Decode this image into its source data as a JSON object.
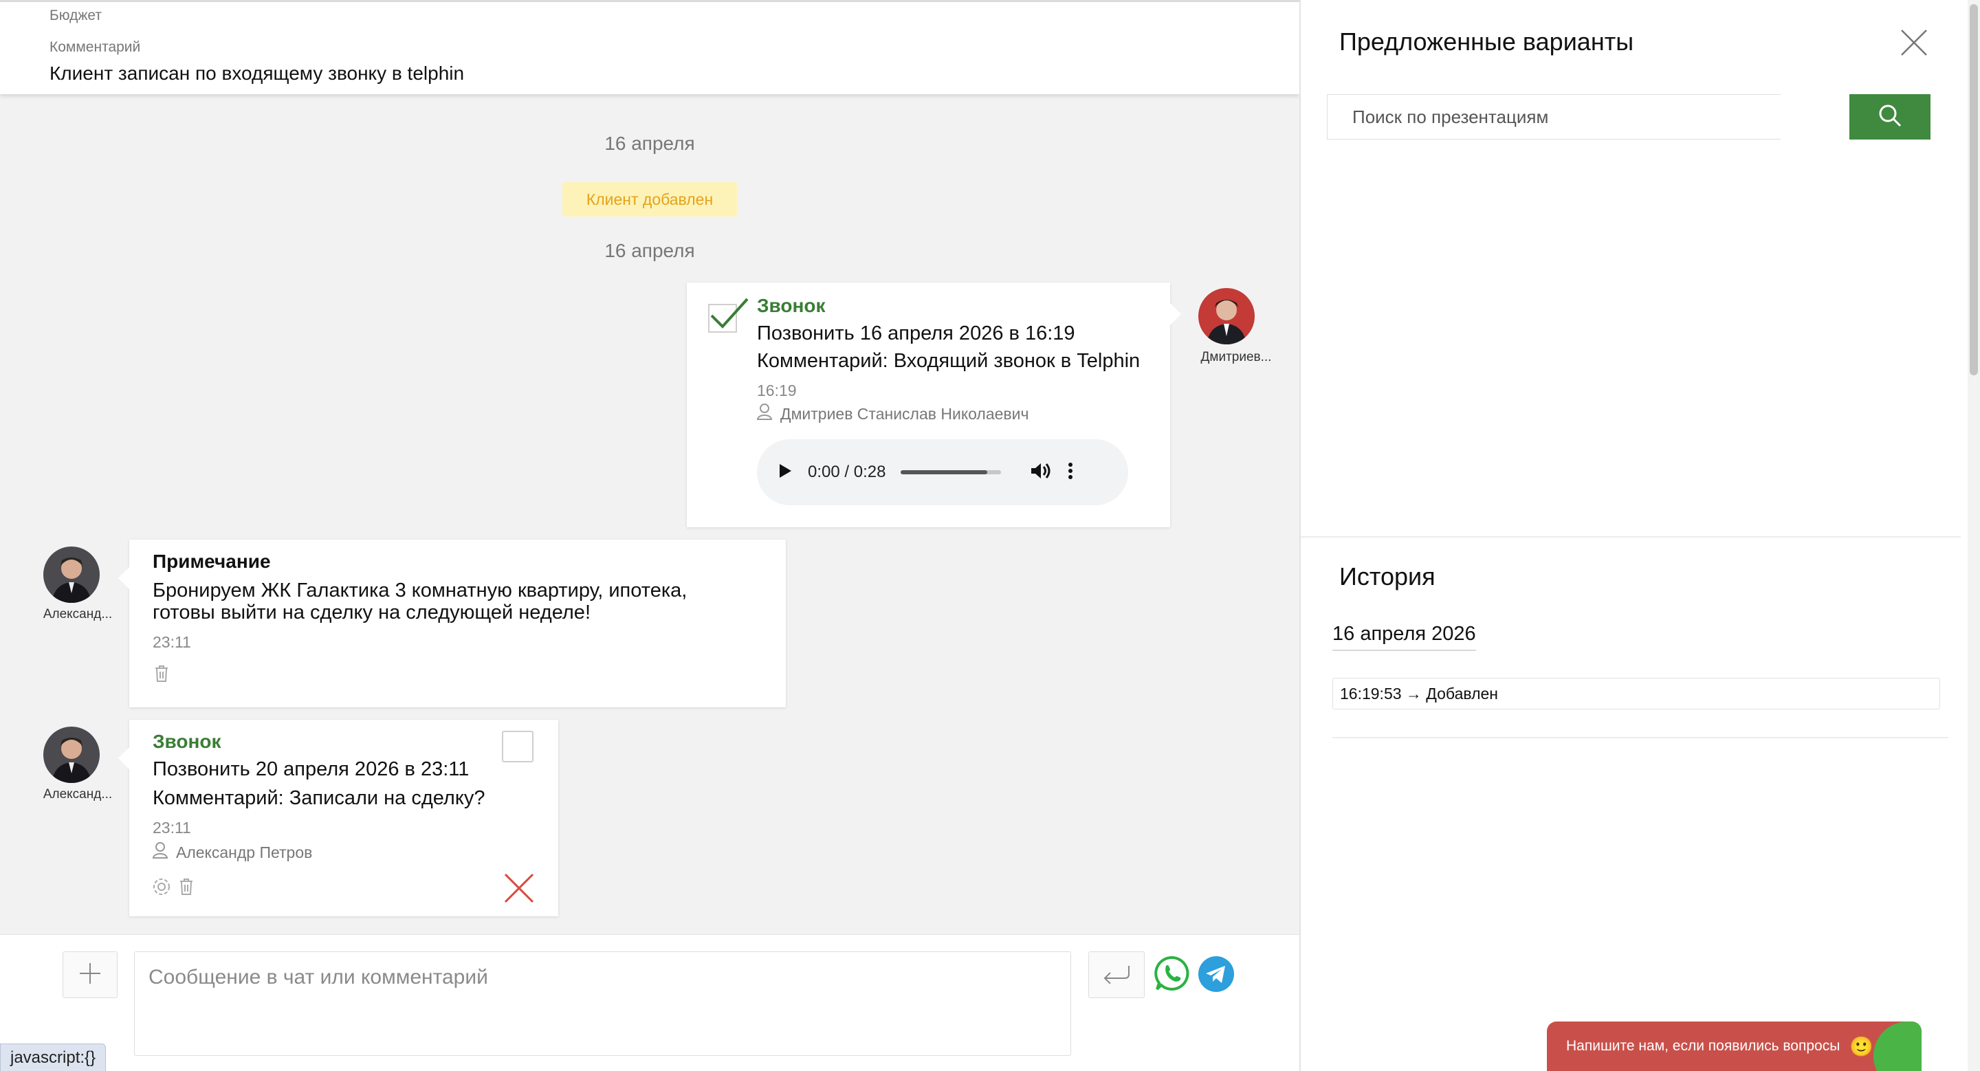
{
  "header": {
    "budget_label": "Бюджет",
    "comment_label": "Комментарий",
    "comment_value": "Клиент записан по входящему звонку в telphin"
  },
  "feed": {
    "date_1": "16 апреля",
    "client_added_badge": "Клиент добавлен",
    "date_2": "16 апреля",
    "call_done": {
      "title": "Звонок",
      "line1": "Позвонить 16 апреля 2026 в 16:19",
      "line2": "Комментарий: Входящий звонок в Telphin",
      "time": "16:19",
      "author": "Дмитриев Станислав Николаевич",
      "avatar_name": "Дмитриев...",
      "audio": {
        "current": "0:00",
        "duration": "0:28",
        "separator": "/",
        "progress_fraction": 0.86
      }
    },
    "note": {
      "title": "Примечание",
      "line1": "Бронируем ЖК Галактика 3 комнатную квартиру, ипотека,",
      "line2": "готовы выйти на сделку на следующей неделе!",
      "time": "23:11",
      "avatar_name": "Александ..."
    },
    "call_pending": {
      "title": "Звонок",
      "line1": "Позвонить 20 апреля 2026 в 23:11",
      "line2": "Комментарий: Записали на сделку?",
      "time": "23:11",
      "author": "Александр Петров",
      "avatar_name": "Александ..."
    }
  },
  "composer": {
    "placeholder": "Сообщение в чат или комментарий"
  },
  "status_tip": "javascript:{}",
  "right_panel": {
    "title": "Предложенные варианты",
    "search_placeholder": "Поиск по презентациям",
    "history_title": "История",
    "history_date": "16 апреля 2026",
    "history_entry": "16:19:53 → Добавлен"
  },
  "help_widget": {
    "text": "Напишите нам, если появились вопросы",
    "emoji": "🙂"
  },
  "colors": {
    "accent_green": "#3a7d35",
    "badge_bg": "#fdf3b8",
    "badge_text": "#e5a21a",
    "help_red": "#c9504a",
    "delete_red": "#d84a3e",
    "telegram_blue": "#2c9fdc",
    "whatsapp_green": "#2ab243"
  }
}
